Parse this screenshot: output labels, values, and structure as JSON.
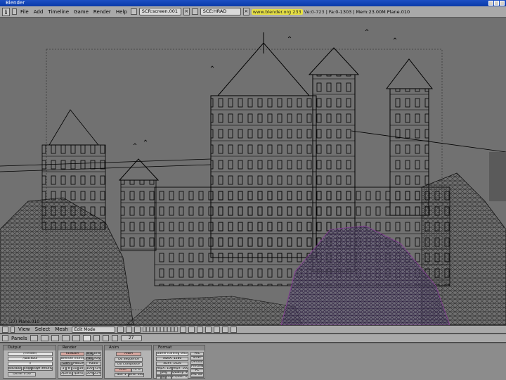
{
  "window": {
    "title": "Blender"
  },
  "menu": [
    "File",
    "Add",
    "Timeline",
    "Game",
    "Render",
    "Help"
  ],
  "screen_field": "SCR:screen.001",
  "scene_field": "SCE:HRAD",
  "stats": {
    "url": "www.blender.org 233",
    "version": "Ve:0-723",
    "faces": "Fa:0-1303",
    "memory": "Mem:23.00M",
    "object": "Plane.010"
  },
  "viewport": {
    "label": "(27) Plane.010"
  },
  "viewport_header": {
    "menus": [
      "View",
      "Select",
      "Mesh"
    ],
    "mode": "Edit Mode"
  },
  "buttons_header": {
    "label": "Panels",
    "frame": "27"
  },
  "panels": {
    "output": {
      "title": "Output",
      "fields": [
        "//render/",
        "//backbuf",
        "//",
        "Backbuf",
        "Edge",
        "Edge Settings"
      ],
      "footer": "Dither  0.00"
    },
    "render": {
      "title": "Render",
      "buttons": [
        "RENDER",
        "Blender Internal",
        "OSA",
        "MBLUR",
        "5",
        "8",
        "11",
        "16",
        "Xparts: 1",
        "Yparts: 1",
        "Fields",
        "Odd",
        "Sky",
        "Premul",
        "Key",
        "Border",
        "Gamma",
        "Shadow",
        "EnvMap",
        "Pano",
        "Ray",
        "Radio",
        "100%",
        "75%",
        "50%",
        "25%"
      ]
    },
    "anim": {
      "title": "Anim",
      "buttons": [
        "ANIM",
        "Do Sequence",
        "Do Composite",
        "PLAY",
        "rt: 0",
        "Sta: 1",
        "End: 140"
      ]
    },
    "format": {
      "title": "Format",
      "buttons": [
        "Game framing settings",
        "SizeX: 1280",
        "SizeY: 1024",
        "AspX: 100",
        "AspY: 100",
        "Jpeg",
        "Quality: 90",
        "Frs/sec: 25",
        "BW",
        "RGB",
        "RGBA",
        "PAL",
        "NTSC",
        "Default",
        "Preview",
        "PC",
        "PAL 16:9",
        "PANO",
        "FULL"
      ]
    }
  }
}
